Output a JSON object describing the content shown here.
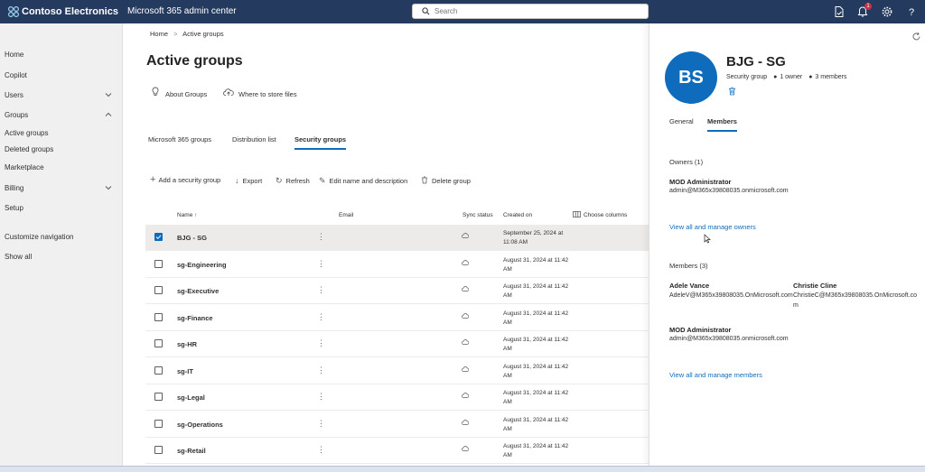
{
  "header": {
    "brand": "Contoso Electronics",
    "app_name": "Microsoft 365 admin center",
    "search_placeholder": "Search",
    "notification_count": "1",
    "accent": "#243a5e"
  },
  "left_nav": {
    "items": [
      {
        "label": "Home"
      },
      {
        "label": "Copilot"
      },
      {
        "label": "Users"
      },
      {
        "label": "Groups"
      },
      {
        "label": "Active groups"
      },
      {
        "label": "Deleted groups"
      },
      {
        "label": "Marketplace"
      },
      {
        "label": "Billing"
      },
      {
        "label": "Setup"
      },
      {
        "label": "Customize navigation"
      },
      {
        "label": "Show all"
      }
    ]
  },
  "main": {
    "breadcrumb": {
      "home": "Home",
      "separator": ">",
      "current": "Active groups"
    },
    "title": "Active groups",
    "links": {
      "about": "About Groups",
      "store": "Where to store files"
    },
    "tabs": [
      "Microsoft 365 groups",
      "Distribution list",
      "Security groups"
    ],
    "commands": [
      "Add a security group",
      "Export",
      "Refresh",
      "Edit name and description",
      "Delete group"
    ],
    "columns": {
      "name": "Name",
      "sort": "↑",
      "email": "Email",
      "sync": "Sync status",
      "created": "Created on",
      "choose": "Choose columns"
    },
    "rows": [
      {
        "name": "BJG - SG",
        "created": "September 25, 2024 at 11:08 AM"
      },
      {
        "name": "sg-Engineering",
        "created": "August 31, 2024 at 11:42 AM"
      },
      {
        "name": "sg-Executive",
        "created": "August 31, 2024 at 11:42 AM"
      },
      {
        "name": "sg-Finance",
        "created": "August 31, 2024 at 11:42 AM"
      },
      {
        "name": "sg-HR",
        "created": "August 31, 2024 at 11:42 AM"
      },
      {
        "name": "sg-IT",
        "created": "August 31, 2024 at 11:42 AM"
      },
      {
        "name": "sg-Legal",
        "created": "August 31, 2024 at 11:42 AM"
      },
      {
        "name": "sg-Operations",
        "created": "August 31, 2024 at 11:42 AM"
      },
      {
        "name": "sg-Retail",
        "created": "August 31, 2024 at 11:42 AM"
      }
    ]
  },
  "panel": {
    "avatar_initials": "BS",
    "group_name": "BJG - SG",
    "group_type": "Security group",
    "owners_count": "1 owner",
    "members_count": "3 members",
    "tabs": [
      "General",
      "Members"
    ],
    "owners_heading": "Owners (1)",
    "owners": [
      {
        "name": "MOD Administrator",
        "email": "admin@M365x39808035.onmicrosoft.com"
      }
    ],
    "owners_link": "View all and manage owners",
    "members_heading": "Members (3)",
    "members": [
      {
        "name": "Adele Vance",
        "email": "AdeleV@M365x39808035.OnMicrosoft.com"
      },
      {
        "name": "Christie Cline",
        "email": "ChristieC@M365x39808035.OnMicrosoft.com"
      },
      {
        "name": "MOD Administrator",
        "email": "admin@M365x39808035.onmicrosoft.com"
      }
    ],
    "members_link": "View all and manage members"
  }
}
